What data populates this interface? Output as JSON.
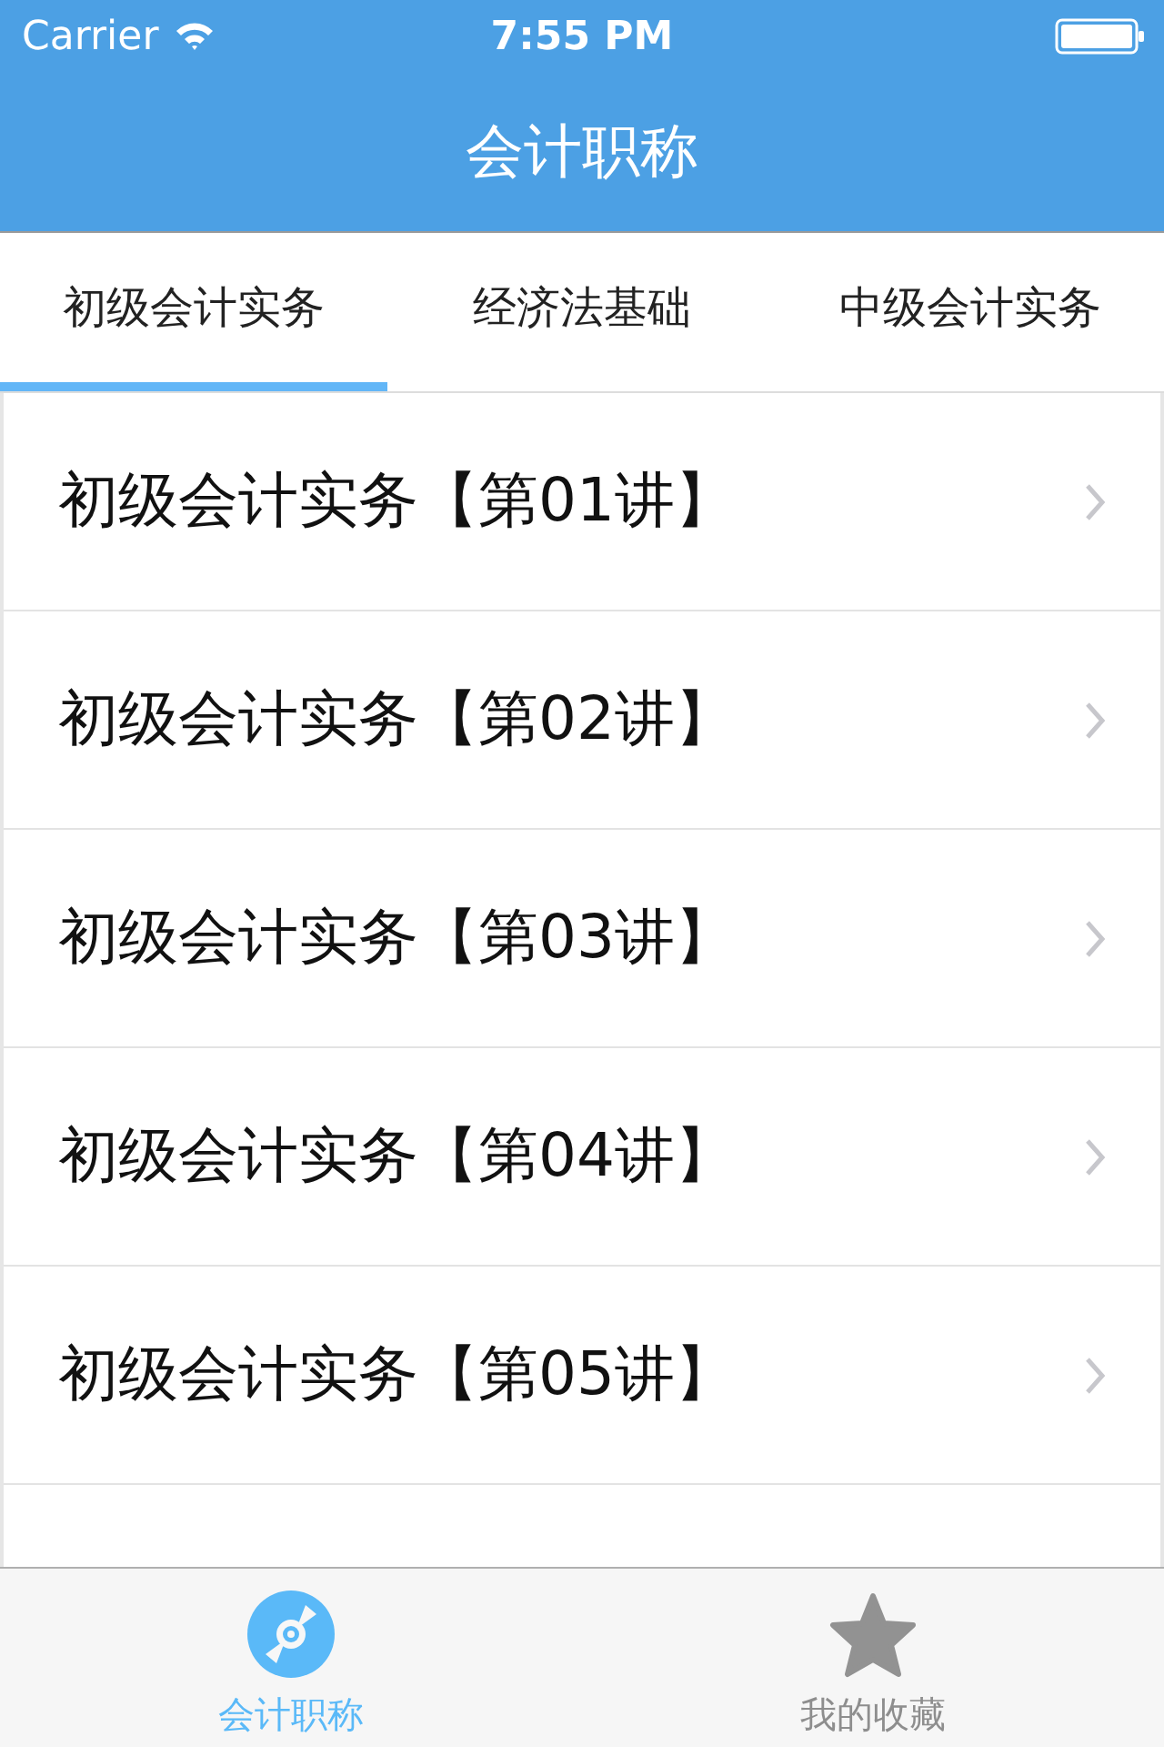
{
  "status_bar": {
    "carrier": "Carrier",
    "time": "7:55 PM"
  },
  "nav_bar": {
    "title": "会计职称"
  },
  "tabs": [
    {
      "label": "初级会计实务",
      "selected": true
    },
    {
      "label": "经济法基础",
      "selected": false
    },
    {
      "label": "中级会计实务",
      "selected": false
    }
  ],
  "lessons": [
    {
      "title": "初级会计实务【第01讲】"
    },
    {
      "title": "初级会计实务【第02讲】"
    },
    {
      "title": "初级会计实务【第03讲】"
    },
    {
      "title": "初级会计实务【第04讲】"
    },
    {
      "title": "初级会计实务【第05讲】"
    }
  ],
  "tab_bar": [
    {
      "label": "会计职称",
      "kind": "disc",
      "selected": true
    },
    {
      "label": "我的收藏",
      "kind": "star",
      "selected": false
    }
  ]
}
